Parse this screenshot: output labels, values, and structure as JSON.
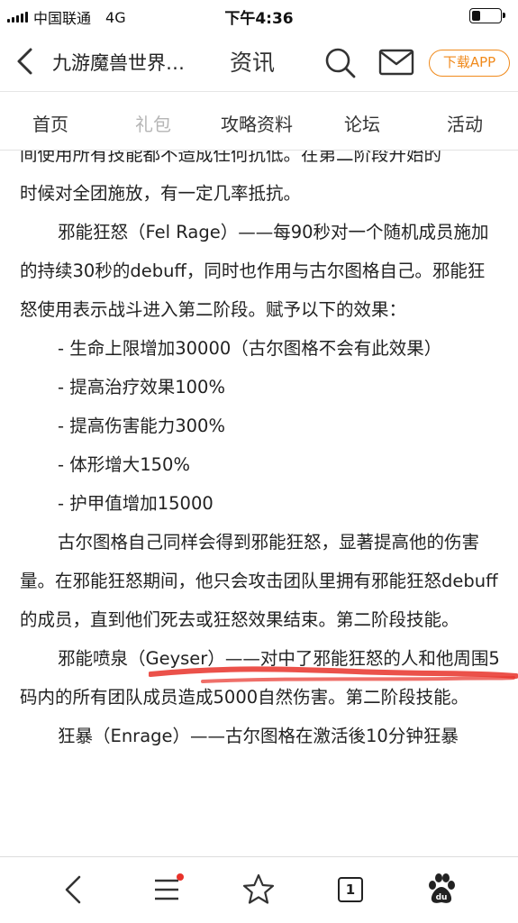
{
  "status_bar": {
    "carrier": "中国联通",
    "network": "4G",
    "time": "下午4:36",
    "battery_level": 0.3
  },
  "header": {
    "site_title": "九游魔兽世界…",
    "center_label": "资讯",
    "download_label": "下载APP",
    "back_icon": "chevron-left-icon",
    "search_icon": "search-icon",
    "mail_icon": "mail-icon",
    "accent_color": "#f08a1c"
  },
  "nav": {
    "tabs": [
      {
        "label": "首页",
        "active": false
      },
      {
        "label": "礼包",
        "dimmed": true
      },
      {
        "label": "攻略资料"
      },
      {
        "label": "论坛"
      },
      {
        "label": "活动"
      }
    ]
  },
  "article": {
    "paragraphs": [
      {
        "type": "clipped",
        "text": "间使用所有技能都不造成任何抗低。在第二阶段开始的"
      },
      {
        "type": "plain",
        "text": "时候对全团施放，有一定几率抵抗。"
      },
      {
        "type": "indent",
        "text": "邪能狂怒（Fel Rage）——每90秒对一个随机成员施加的持续30秒的debuff，同时也作用与古尔图格自己。邪能狂怒使用表示战斗进入第二阶段。赋予以下的效果："
      },
      {
        "type": "bullet",
        "text": "- 生命上限增加30000（古尔图格不会有此效果）"
      },
      {
        "type": "bullet",
        "text": "- 提高治疗效果100%"
      },
      {
        "type": "bullet",
        "text": "- 提高伤害能力300%"
      },
      {
        "type": "bullet",
        "text": "- 体形增大150%"
      },
      {
        "type": "bullet",
        "text": "- 护甲值增加15000"
      },
      {
        "type": "indent",
        "text": "古尔图格自己同样会得到邪能狂怒，显著提高他的伤害量。在邪能狂怒期间，他只会攻击团队里拥有邪能狂怒debuff的成员，直到他们死去或狂怒效果结束。第二阶段技能。"
      },
      {
        "type": "indent",
        "text": "邪能喷泉（Geyser）——对中了邪能狂怒的人和他周围5码内的所有团队成员造成5000自然伤害。第二阶段技能。"
      },
      {
        "type": "indent",
        "text": "狂暴（Enrage）——古尔图格在激活後10分钟狂暴"
      }
    ],
    "annotation_color": "#e8322a"
  },
  "bottom_bar": {
    "back_icon": "chevron-left-icon",
    "menu_icon": "menu-icon",
    "star_icon": "star-icon",
    "tab_count": "1",
    "baidu_icon": "baidu-paw-icon",
    "notification_color": "#e8322a"
  }
}
